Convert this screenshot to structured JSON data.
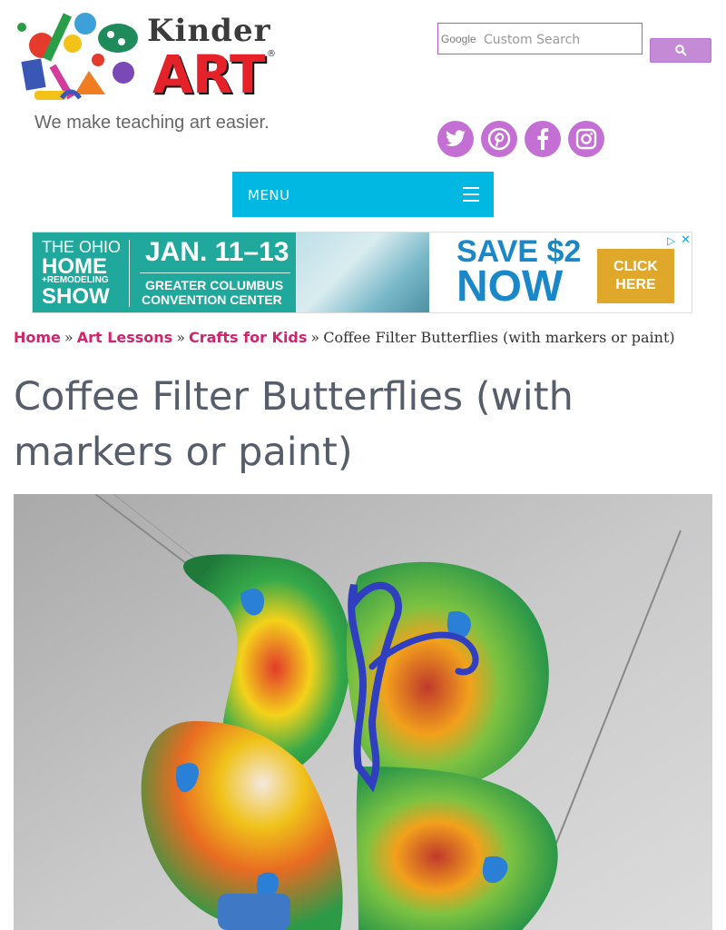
{
  "header": {
    "logo": {
      "title": "Kinder",
      "art": "ART",
      "registered": "®",
      "tagline": "We make teaching art easier."
    },
    "search": {
      "google_label": "Google",
      "placeholder": "Custom Search",
      "button_icon": "search-icon"
    },
    "social": [
      {
        "name": "twitter",
        "icon": "twitter-icon"
      },
      {
        "name": "pinterest",
        "icon": "pinterest-icon"
      },
      {
        "name": "facebook",
        "icon": "facebook-icon"
      },
      {
        "name": "instagram",
        "icon": "instagram-icon"
      }
    ],
    "accent_color": "#c46fd4"
  },
  "menu": {
    "label": "MENU",
    "icon": "hamburger-icon",
    "color": "#00b8e2"
  },
  "ad": {
    "brand_line1": "THE OHIO",
    "brand_line2": "HOME",
    "brand_line3": "+REMODELING",
    "brand_line4": "SHOW",
    "dates": "JAN. 11–13",
    "venue_line1": "GREATER COLUMBUS",
    "venue_line2": "CONVENTION CENTER",
    "offer_line1": "SAVE $2",
    "offer_line2": "NOW",
    "cta": "CLICK HERE",
    "adchoices_icon": "adchoices-icon",
    "close_icon": "close-icon"
  },
  "breadcrumb": {
    "items": [
      "Home",
      "Art Lessons",
      "Crafts for Kids"
    ],
    "separator": "»",
    "current": "Coffee Filter Butterflies (with markers or paint)",
    "link_color": "#d1246d"
  },
  "article": {
    "title": "Coffee Filter Butterflies (with markers or paint)",
    "hero_alt": "Coffee filter butterfly"
  }
}
